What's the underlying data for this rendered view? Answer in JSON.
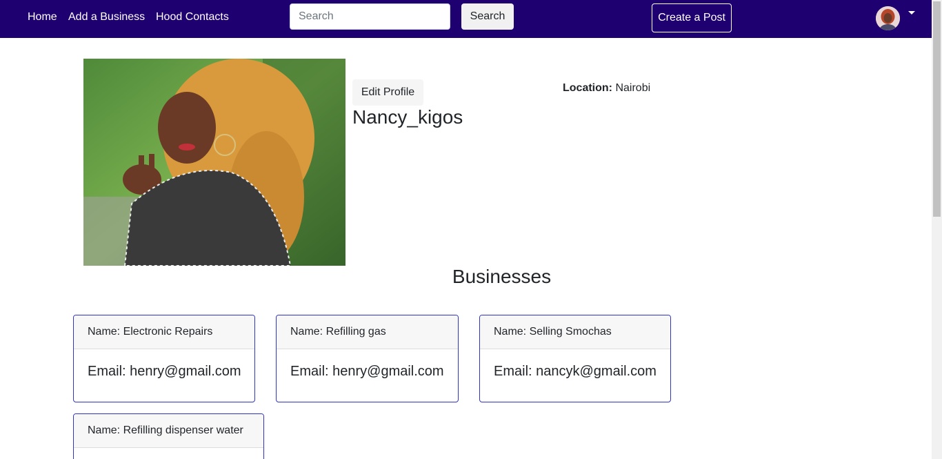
{
  "nav": {
    "links": [
      "Home",
      "Add a Business",
      "Hood Contacts"
    ],
    "search_placeholder": "Search",
    "search_button": "Search",
    "create_post": "Create a Post"
  },
  "profile": {
    "edit_button": "Edit Profile",
    "username": "Nancy_kigos",
    "location_label": "Location:",
    "location_value": "Nairobi"
  },
  "businesses": {
    "title": "Businesses",
    "items": [
      {
        "name": "Name: Electronic Repairs",
        "email": "Email: henry@gmail.com"
      },
      {
        "name": "Name: Refilling gas",
        "email": "Email: henry@gmail.com"
      },
      {
        "name": "Name: Selling Smochas",
        "email": "Email: nancyk@gmail.com"
      },
      {
        "name": "Name: Refilling dispenser water",
        "email": ""
      }
    ]
  },
  "colors": {
    "navbar": "#1f0070",
    "card_border": "#3033c0"
  }
}
